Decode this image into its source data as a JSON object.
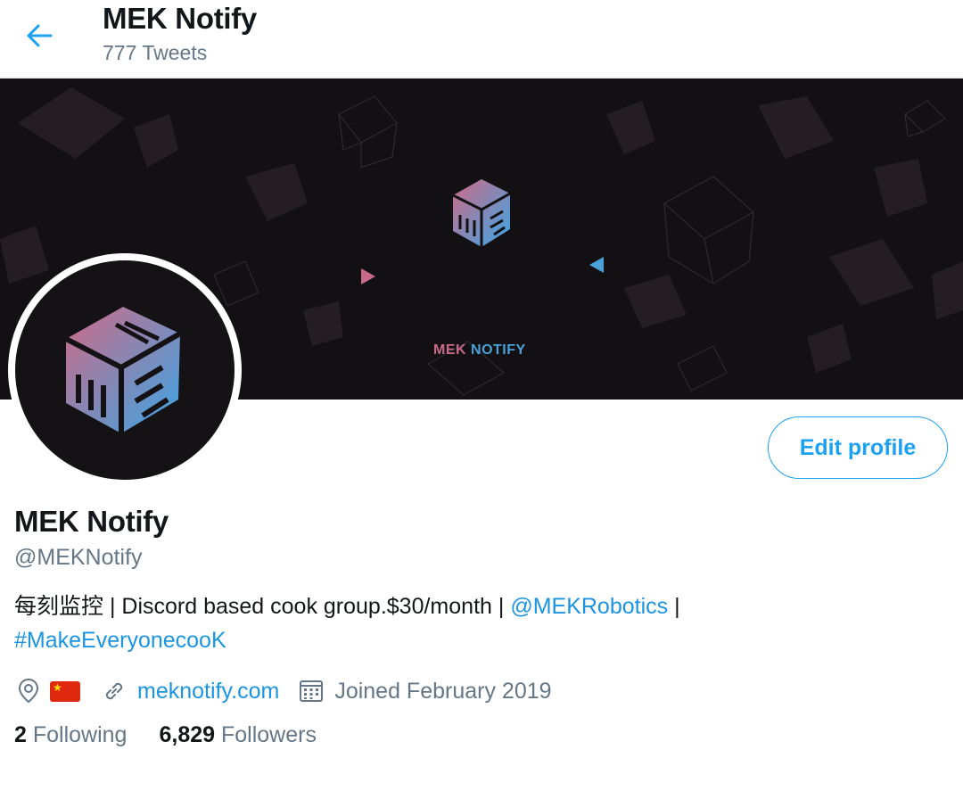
{
  "header": {
    "display_name": "MEK Notify",
    "tweet_count": "777 Tweets"
  },
  "banner": {
    "wordmark_part1": "MEK",
    "wordmark_part2": "NOTIFY"
  },
  "profile": {
    "display_name": "MEK Notify",
    "handle": "@MEKNotify",
    "edit_label": "Edit profile",
    "bio_text": "每刻监控 | Discord based cook group.$30/month | ",
    "bio_mention": "@MEKRobotics",
    "bio_separator": " |",
    "bio_hashtag": "#MakeEveryonecooK",
    "location_flag": "China flag",
    "website": "meknotify.com",
    "joined": "Joined February 2019",
    "following_count": "2",
    "following_label": "Following",
    "followers_count": "6,829",
    "followers_label": "Followers"
  },
  "icons": [
    "back-arrow-icon",
    "location-pin-icon",
    "link-icon",
    "calendar-icon"
  ],
  "colors": {
    "accent": "#1da1f2",
    "link": "#1b95e0",
    "muted": "#657786",
    "banner_bg": "#121012"
  }
}
